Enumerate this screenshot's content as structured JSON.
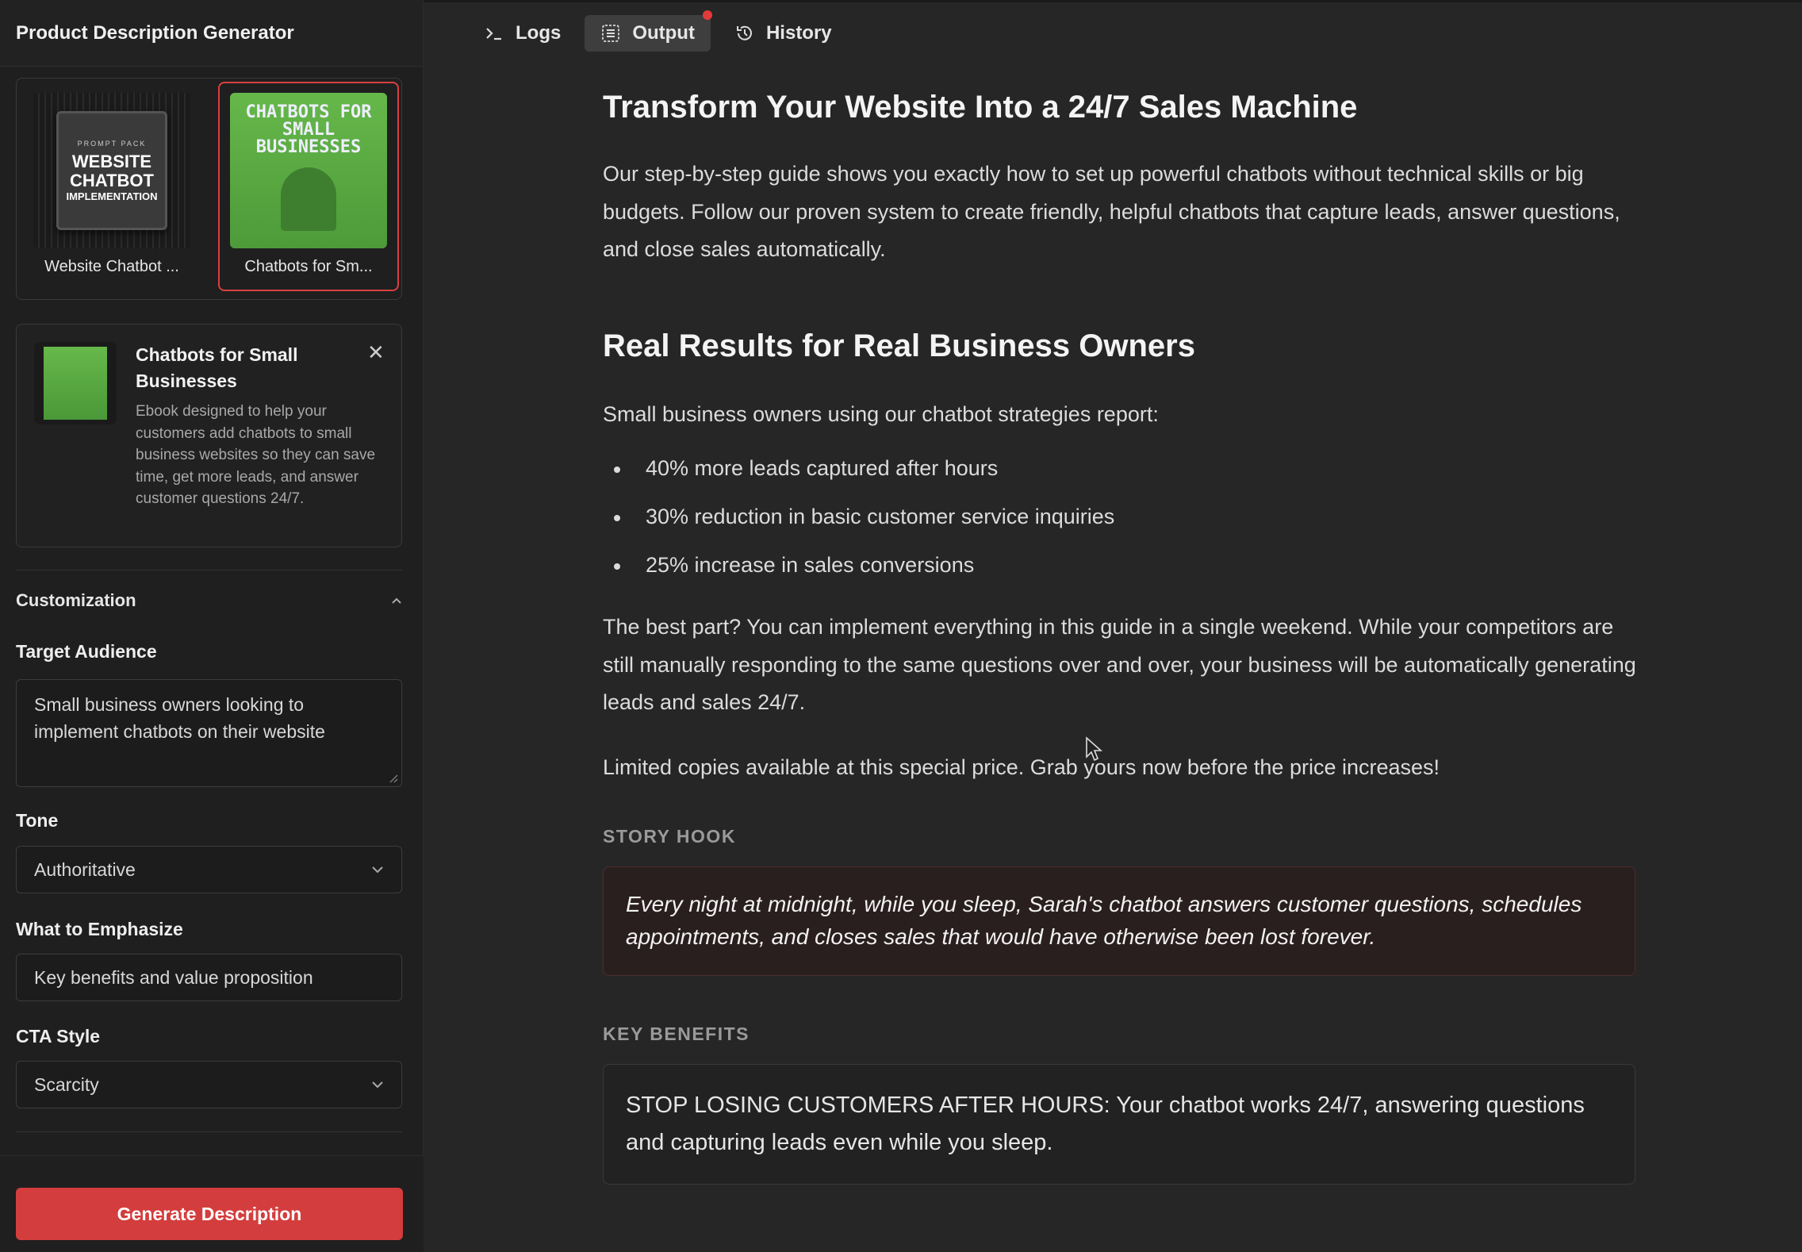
{
  "sidebar": {
    "title": "Product Description Generator",
    "products": [
      {
        "label": "Website Chatbot ...",
        "cover_small": "PROMPT PACK",
        "cover_big": "WEBSITE CHATBOT",
        "cover_sub": "IMPLEMENTATION",
        "selected": false
      },
      {
        "label": "Chatbots for Sm...",
        "cover_big": "CHATBOTS FOR SMALL BUSINESSES",
        "selected": true
      }
    ],
    "detail": {
      "title": "Chatbots for Small Businesses",
      "description": "Ebook designed to help your customers add chatbots to small business websites so they can save time, get more leads, and answer customer questions 24/7."
    },
    "customization": {
      "heading": "Customization",
      "target_audience_label": "Target Audience",
      "target_audience_value": "Small business owners looking to implement chatbots on their website",
      "tone_label": "Tone",
      "tone_value": "Authoritative",
      "emphasize_label": "What to Emphasize",
      "emphasize_value": "Key benefits and value proposition",
      "cta_label": "CTA Style",
      "cta_value": "Scarcity"
    },
    "generate_label": "Generate Description"
  },
  "tabs": {
    "logs": "Logs",
    "output": "Output",
    "history": "History"
  },
  "content": {
    "heading1": "Transform Your Website Into a 24/7 Sales Machine",
    "para1": "Our step-by-step guide shows you exactly how to set up powerful chatbots without technical skills or big budgets. Follow our proven system to create friendly, helpful chatbots that capture leads, answer questions, and close sales automatically.",
    "heading2": "Real Results for Real Business Owners",
    "para2": "Small business owners using our chatbot strategies report:",
    "stats": [
      "40% more leads captured after hours",
      "30% reduction in basic customer service inquiries",
      "25% increase in sales conversions"
    ],
    "para3": "The best part? You can implement everything in this guide in a single weekend. While your competitors are still manually responding to the same questions over and over, your business will be automatically generating leads and sales 24/7.",
    "para4": "Limited copies available at this special price. Grab yours now before the price increases!",
    "story_hook_label": "STORY HOOK",
    "story_hook": "Every night at midnight, while you sleep, Sarah's chatbot answers customer questions, schedules appointments, and closes sales that would have otherwise been lost forever.",
    "key_benefits_label": "KEY BENEFITS",
    "benefit1": "STOP LOSING CUSTOMERS AFTER HOURS: Your chatbot works 24/7, answering questions and capturing leads even while you sleep."
  },
  "colors": {
    "accent": "#d43d3d",
    "background": "#262626",
    "sidebar": "#1f1f1f"
  }
}
